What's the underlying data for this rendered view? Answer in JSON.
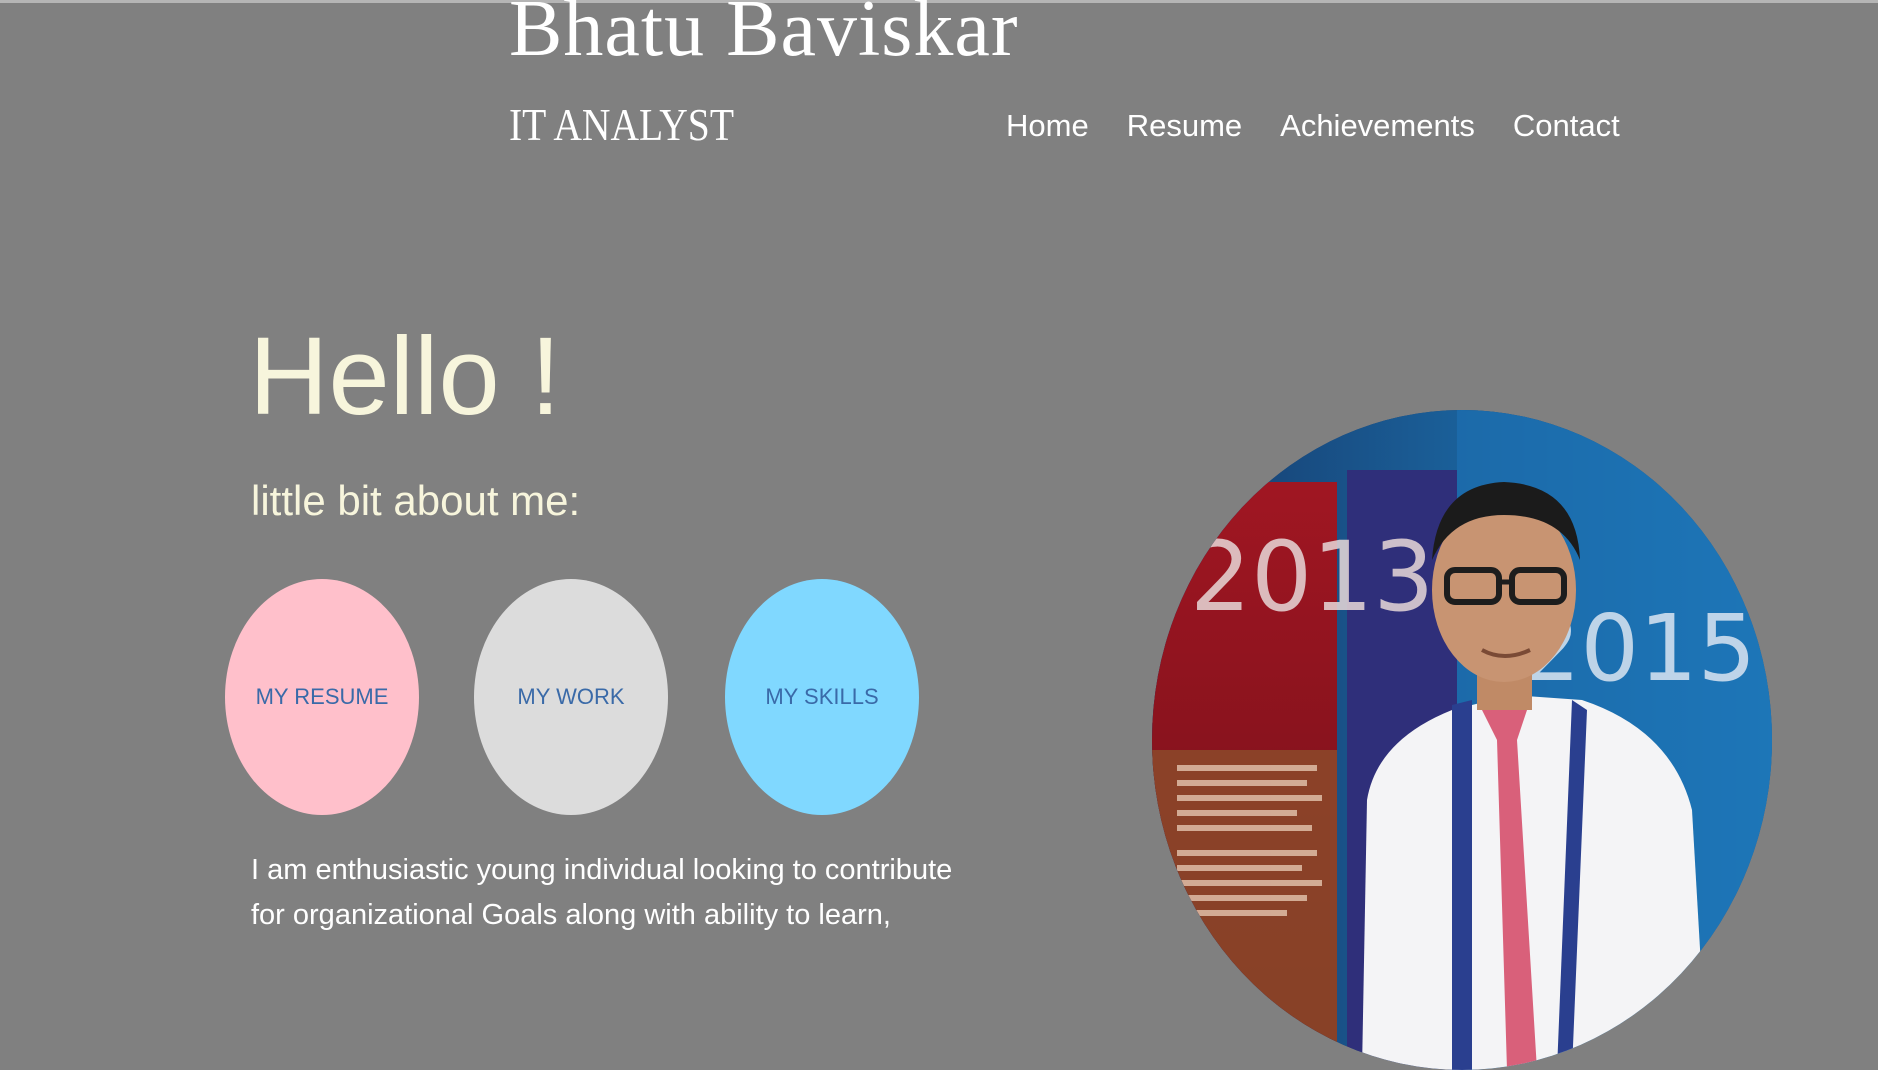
{
  "header": {
    "name": "Bhatu Baviskar",
    "role": "IT ANALYST"
  },
  "nav": {
    "items": [
      {
        "label": "Home"
      },
      {
        "label": "Resume"
      },
      {
        "label": "Achievements"
      },
      {
        "label": "Contact"
      }
    ]
  },
  "hero": {
    "greeting": "Hello !",
    "subtitle": "little bit about me:",
    "buttons": [
      {
        "label": "MY RESUME",
        "color": "#ffc0cb"
      },
      {
        "label": "MY WORK",
        "color": "#dcdcdc"
      },
      {
        "label": "MY SKILLS",
        "color": "#80d8ff"
      }
    ],
    "bio": "I am enthusiastic young individual looking to contribute for organizational Goals along with ability to learn,"
  },
  "photo": {
    "banner_year_left": "2013",
    "banner_year_right": "2015"
  },
  "colors": {
    "background": "#808080",
    "heading": "#f7f5dc",
    "button_text": "#3a6aa8"
  }
}
